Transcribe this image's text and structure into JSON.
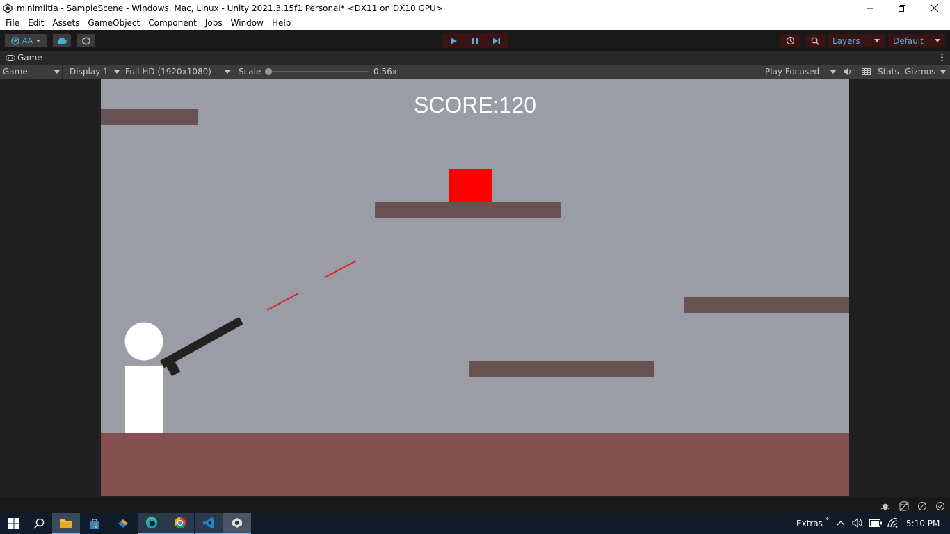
{
  "window": {
    "title": "minimiltia - SampleScene - Windows, Mac, Linux - Unity 2021.3.15f1 Personal* <DX11 on DX10 GPU>"
  },
  "menu": [
    "File",
    "Edit",
    "Assets",
    "GameObject",
    "Component",
    "Jobs",
    "Window",
    "Help"
  ],
  "toolbar": {
    "account_label": "AA",
    "layers_label": "Layers",
    "layout_label": "Default"
  },
  "game_tab": {
    "label": "Game"
  },
  "game_options": {
    "view_mode": "Game",
    "display": "Display 1",
    "resolution": "Full HD (1920x1080)",
    "scale_label": "Scale",
    "scale_value": "0.56x",
    "play_mode": "Play Focused",
    "stats_label": "Stats",
    "gizmos_label": "Gizmos"
  },
  "game": {
    "score_text": "SCORE:120"
  },
  "taskbar": {
    "extras_label": "Extras",
    "time": "5:10 PM"
  },
  "colors": {
    "sky": "#9a9da5",
    "ground": "#864f4f",
    "platform": "#695252",
    "target": "#ff0000",
    "laser": "#e02020"
  }
}
